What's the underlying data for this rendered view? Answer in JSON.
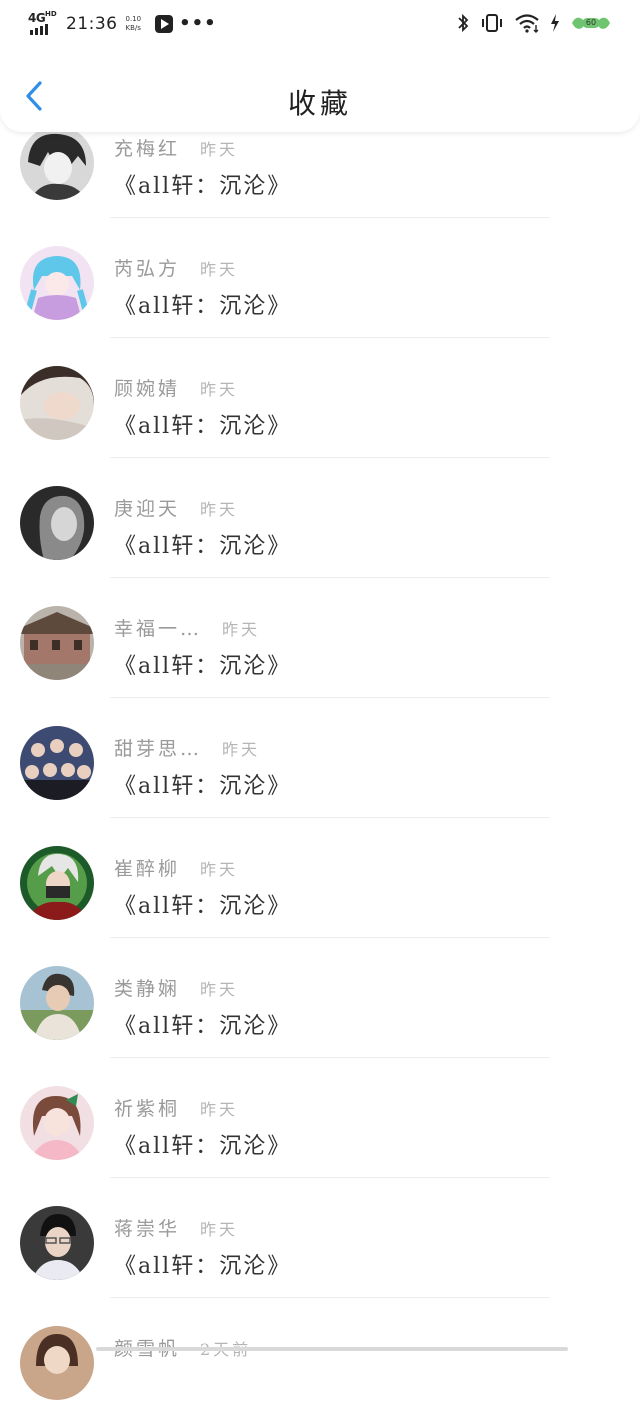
{
  "status_bar": {
    "network": "4G",
    "network_hd": "HD",
    "time": "21:36",
    "speed_value": "0.10",
    "speed_unit": "KB/s",
    "more": "•••",
    "battery_level": "60"
  },
  "header": {
    "title": "收藏"
  },
  "favorites": [
    {
      "name": "充梅红",
      "time": "昨天",
      "book": "《all轩：沉沦》"
    },
    {
      "name": "芮弘方",
      "time": "昨天",
      "book": "《all轩：沉沦》"
    },
    {
      "name": "顾婉婧",
      "time": "昨天",
      "book": "《all轩：沉沦》"
    },
    {
      "name": "庚迎天",
      "time": "昨天",
      "book": "《all轩：沉沦》"
    },
    {
      "name": "幸福一…",
      "time": "昨天",
      "book": "《all轩：沉沦》"
    },
    {
      "name": "甜芽思…",
      "time": "昨天",
      "book": "《all轩：沉沦》"
    },
    {
      "name": "崔醉柳",
      "time": "昨天",
      "book": "《all轩：沉沦》"
    },
    {
      "name": "类静娴",
      "time": "昨天",
      "book": "《all轩：沉沦》"
    },
    {
      "name": "祈紫桐",
      "time": "昨天",
      "book": "《all轩：沉沦》"
    },
    {
      "name": "蒋崇华",
      "time": "昨天",
      "book": "《all轩：沉沦》"
    },
    {
      "name": "颜雪帆",
      "time": "2天前",
      "book": ""
    }
  ],
  "colors": {
    "accent": "#2f8fe8",
    "name_gray": "#9a9a9a",
    "time_gray": "#b5b5b5",
    "text_dark": "#333333"
  }
}
